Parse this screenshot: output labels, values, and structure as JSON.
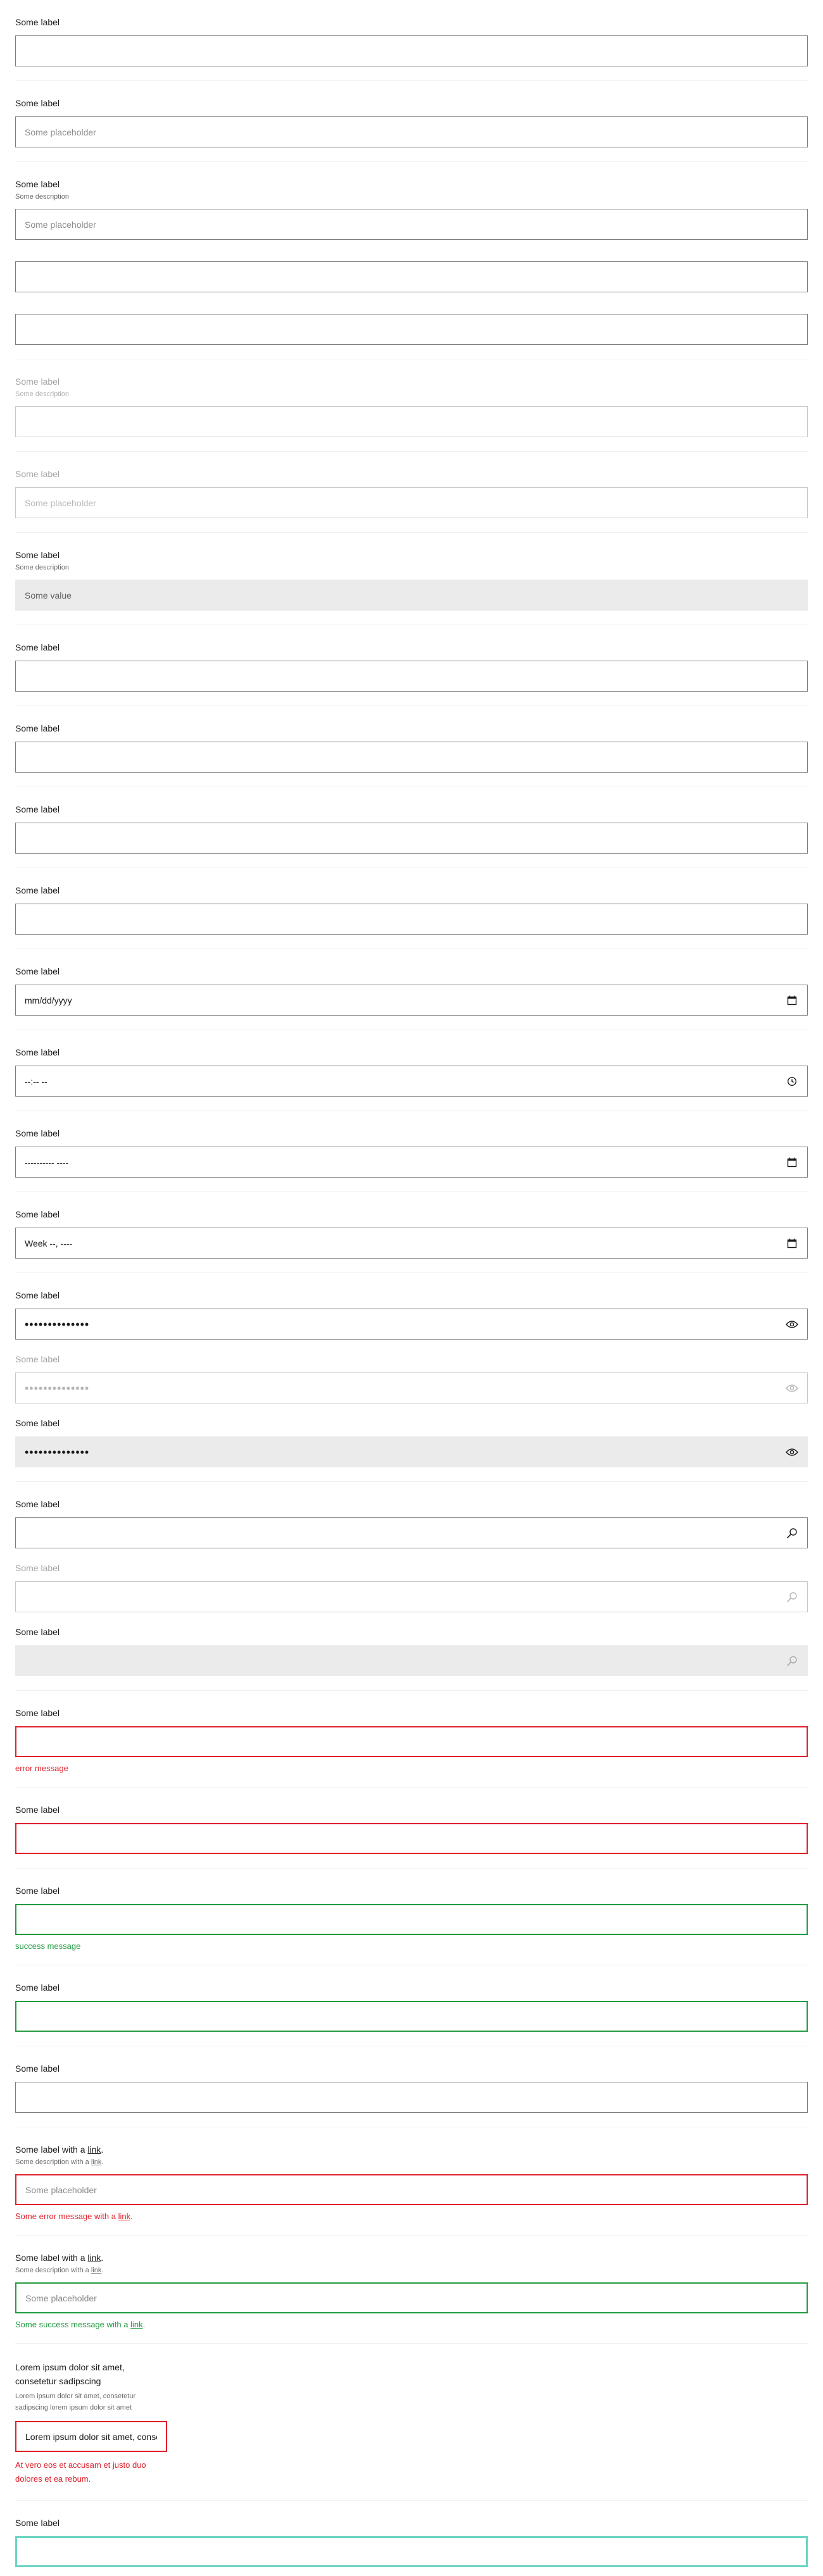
{
  "common": {
    "label": "Some label",
    "description": "Some description",
    "placeholder": "Some placeholder",
    "value": "Some value",
    "password_mask": "••••••••••••••"
  },
  "date": {
    "format": "mm/dd/yyyy"
  },
  "time": {
    "format": "--:-- --"
  },
  "datetime": {
    "format": "---------- ----"
  },
  "week": {
    "format": "Week --, ----"
  },
  "messages": {
    "error": "error message",
    "success": "success message"
  },
  "link_fields": {
    "label_prefix": "Some label with a ",
    "description_prefix": "Some description with a ",
    "link_text": "link",
    "suffix": ".",
    "error_prefix": "Some error message with a ",
    "success_prefix": "Some success message with a "
  },
  "long_text": {
    "label": "Lorem ipsum dolor sit amet, consetetur sadipscing",
    "description": "Lorem ipsum dolor sit amet, consetetur sadipscing lorem ipsum dolor sit amet",
    "value": "Lorem ipsum dolor sit amet, conset",
    "error": "At vero eos et accusam et justo duo dolores et ea rebum."
  },
  "colors": {
    "error": "#e0202b",
    "success": "#219a41",
    "focus": "#6cd5c4",
    "readonly_bg": "#ebebeb"
  },
  "icons": [
    "calendar-icon",
    "clock-icon",
    "eye-icon",
    "search-icon"
  ]
}
